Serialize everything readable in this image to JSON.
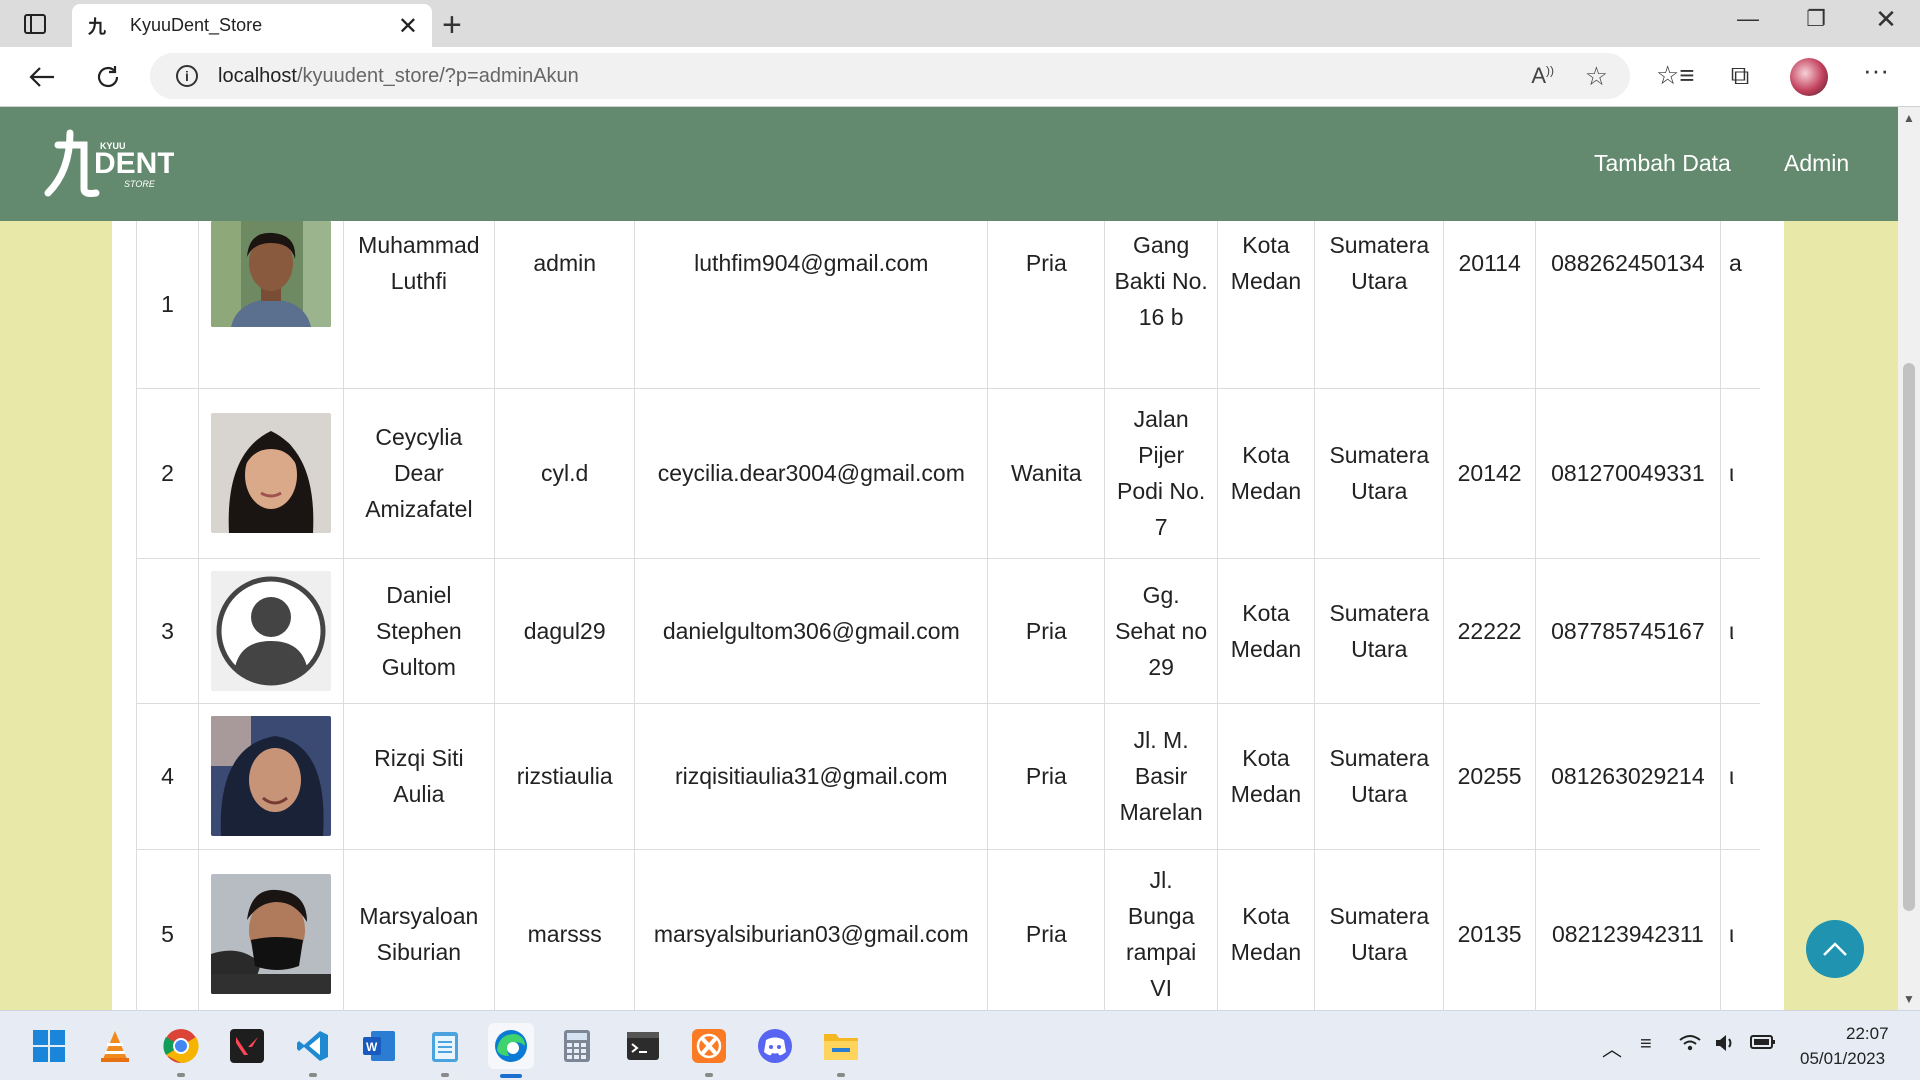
{
  "browser": {
    "tab_title": "KyuuDent_Store",
    "tab_favicon": "九",
    "url_host": "localhost",
    "url_path": "/kyuudent_store/?p=adminAkun",
    "read_aloud_glyph": "Aͅ",
    "window_controls": {
      "minimize": "—",
      "restore": "❐",
      "close": "✕"
    },
    "new_tab": "+",
    "tab_close": "✕"
  },
  "site": {
    "nav": {
      "tambah_data": "Tambah Data",
      "admin": "Admin"
    },
    "logo": {
      "kanji": "九",
      "small_top": "KYUU",
      "main": "DENT",
      "small_bottom": "STORE"
    }
  },
  "table": {
    "rows": [
      {
        "no": "1",
        "photo": "male-photo",
        "name": "Muhammad Luthfi",
        "username": "admin",
        "email": "luthfim904@gmail.com",
        "gender": "Pria",
        "address": "Gang Bakti No. 16 b",
        "city": "Kota Medan",
        "province": "Sumatera Utara",
        "zip": "20114",
        "phone": "088262450134",
        "extra": "a"
      },
      {
        "no": "2",
        "photo": "female-photo",
        "name": "Ceycylia Dear Amizafatel",
        "username": "cyl.d",
        "email": "ceycilia.dear3004@gmail.com",
        "gender": "Wanita",
        "address": "Jalan Pijer Podi No. 7",
        "city": "Kota Medan",
        "province": "Sumatera Utara",
        "zip": "20142",
        "phone": "081270049331",
        "extra": "ι"
      },
      {
        "no": "3",
        "photo": "default-avatar",
        "name": "Daniel Stephen Gultom",
        "username": "dagul29",
        "email": "danielgultom306@gmail.com",
        "gender": "Pria",
        "address": "Gg. Sehat no 29",
        "city": "Kota Medan",
        "province": "Sumatera Utara",
        "zip": "22222",
        "phone": "087785745167",
        "extra": "ι"
      },
      {
        "no": "4",
        "photo": "hijab-photo",
        "name": "Rizqi Siti Aulia",
        "username": "rizstiaulia",
        "email": "rizqisitiaulia31@gmail.com",
        "gender": "Pria",
        "address": "Jl. M. Basir Marelan",
        "city": "Kota Medan",
        "province": "Sumatera Utara",
        "zip": "20255",
        "phone": "081263029214",
        "extra": "ι"
      },
      {
        "no": "5",
        "photo": "mask-photo",
        "name": "Marsyaloan Siburian",
        "username": "marsss",
        "email": "marsyalsiburian03@gmail.com",
        "gender": "Pria",
        "address": "Jl. Bunga rampai VI",
        "city": "Kota Medan",
        "province": "Sumatera Utara",
        "zip": "20135",
        "phone": "082123942311",
        "extra": "ι"
      }
    ]
  },
  "taskbar": {
    "apps": [
      "windows-start-icon",
      "vlc-icon",
      "chrome-icon",
      "valorant-icon",
      "vscode-icon",
      "word-icon",
      "notepad-icon",
      "edge-icon",
      "calculator-icon",
      "terminal-icon",
      "xampp-icon",
      "discord-icon",
      "file-explorer-icon"
    ],
    "clock_time": "22:07",
    "clock_date": "05/01/2023"
  },
  "colors": {
    "navbar": "#638a6e",
    "page_bg": "#e8e8a8",
    "scroll_top": "#1f93b0"
  }
}
